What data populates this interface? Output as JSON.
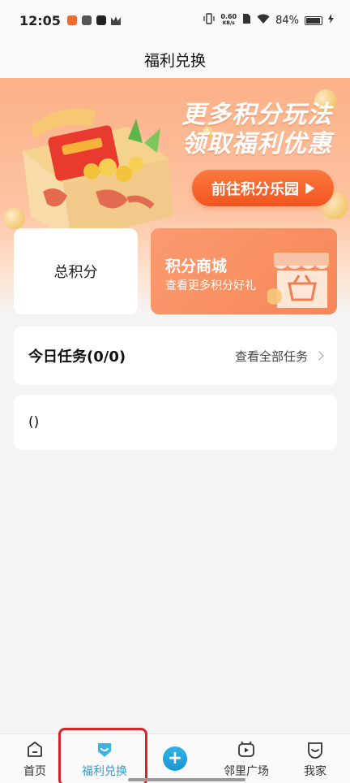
{
  "status_bar": {
    "time": "12:05",
    "net_speed": "0.60",
    "net_unit": "KB/s",
    "battery": "84%"
  },
  "header": {
    "title": "福利兑换"
  },
  "banner": {
    "line1": "更多积分玩法",
    "line2": "领取福利优惠",
    "cta_label": "前往积分乐园"
  },
  "points_card": {
    "label": "总积分"
  },
  "mall_card": {
    "title": "积分商城",
    "subtitle": "查看更多积分好礼"
  },
  "task_card": {
    "title": "今日任务(0/0)",
    "link": "查看全部任务"
  },
  "empty_card": {
    "text": "()"
  },
  "bottom_nav": {
    "items": [
      {
        "label": "首页"
      },
      {
        "label": "福利兑换"
      },
      {
        "label": "+"
      },
      {
        "label": "邻里广场"
      },
      {
        "label": "我家"
      }
    ]
  },
  "colors": {
    "accent_orange": "#f2541e",
    "active_blue": "#2e9bd6",
    "highlight_red": "#d9252a"
  }
}
